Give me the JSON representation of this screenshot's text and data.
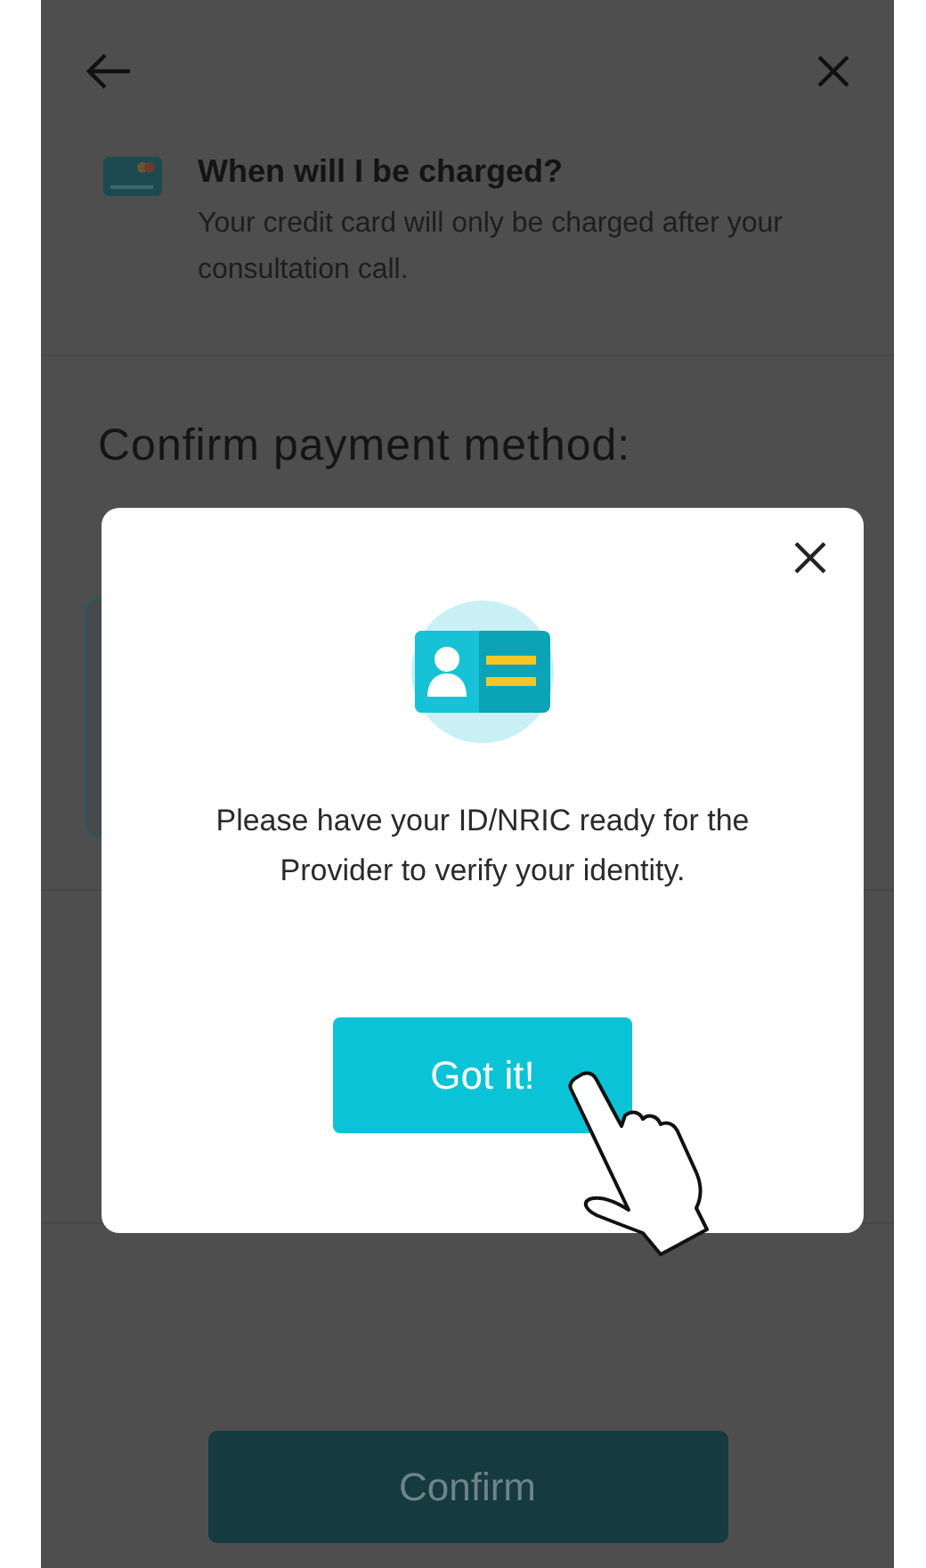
{
  "charge_info": {
    "title": "When will I be charged?",
    "body": "Your credit card will only be charged after your consultation call."
  },
  "payment": {
    "title": "Confirm payment method:"
  },
  "modal": {
    "message": "Please have your ID/NRIC ready for the Provider to verify your identity.",
    "button": "Got it!"
  },
  "confirm_button": {
    "label": "Confirm",
    "disabled": true
  }
}
